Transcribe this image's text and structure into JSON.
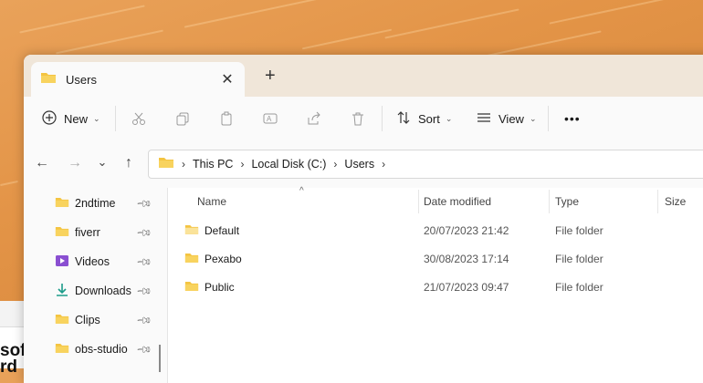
{
  "tab": {
    "title": "Users",
    "close_label": "✕",
    "new_tab_label": "+"
  },
  "toolbar": {
    "new_label": "New",
    "sort_label": "Sort",
    "view_label": "View",
    "more_label": "•••"
  },
  "address": {
    "crumbs": [
      "This PC",
      "Local Disk (C:)",
      "Users"
    ]
  },
  "nav": {
    "items": [
      {
        "label": "2ndtime",
        "icon": "folder-icon"
      },
      {
        "label": "fiverr",
        "icon": "folder-icon"
      },
      {
        "label": "Videos",
        "icon": "videos-icon"
      },
      {
        "label": "Downloads",
        "icon": "download-icon"
      },
      {
        "label": "Clips",
        "icon": "folder-icon"
      },
      {
        "label": "obs-studio",
        "icon": "folder-icon"
      }
    ]
  },
  "columns": {
    "name": "Name",
    "date": "Date modified",
    "type": "Type",
    "size": "Size"
  },
  "files": [
    {
      "name": "Default",
      "date": "20/07/2023 21:42",
      "type": "File folder"
    },
    {
      "name": "Pexabo",
      "date": "30/08/2023 17:14",
      "type": "File folder"
    },
    {
      "name": "Public",
      "date": "21/07/2023 09:47",
      "type": "File folder"
    }
  ],
  "background": {
    "partial_text_1": "sof",
    "partial_text_2": "rd"
  },
  "colors": {
    "folder": "#f4c441",
    "accent": "#0067c0",
    "download": "#1c9c8a",
    "video": "#8a4fd1"
  }
}
